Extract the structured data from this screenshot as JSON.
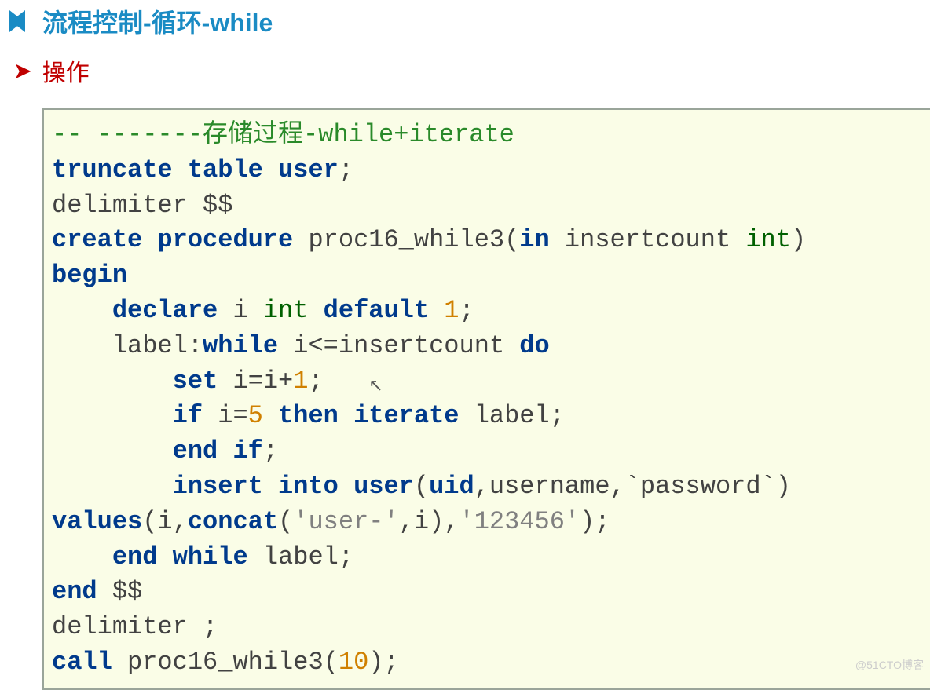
{
  "title": "流程控制-循环-while",
  "subtitle": "操作",
  "watermark": "@51CTO博客",
  "code": {
    "comment": "-- -------存储过程-while+iterate",
    "l1_truncate": "truncate",
    "l1_table": "table",
    "l1_user": "user",
    "l2_delim": "delimiter $$",
    "l3_create": "create",
    "l3_procedure": "procedure",
    "l3_name": " proc16_while3(",
    "l3_in": "in",
    "l3_param": " insertcount ",
    "l3_int": "int",
    "l3_close": ")",
    "l4_begin": "begin",
    "l5_declare": "declare",
    "l5_i": " i ",
    "l5_int": "int",
    "l5_default": "default",
    "l5_one": "1",
    "l6_label": "    label:",
    "l6_while": "while",
    "l6_cond": " i<=insertcount ",
    "l6_do": "do",
    "l7_set": "set",
    "l7_expr1": " i=i",
    "l7_plus": "+",
    "l7_one": "1",
    "l8_if": "if",
    "l8_expr": " i=",
    "l8_five": "5",
    "l8_then": "then",
    "l8_iterate": "iterate",
    "l8_label": " label;",
    "l9_end": "end",
    "l9_if": "if",
    "l10_insert": "insert",
    "l10_into": "into",
    "l10_user": "user",
    "l10_uid": "uid",
    "l10_rest": ",username,`password`)",
    "l11_values": "values",
    "l11_open": "(i,",
    "l11_concat": "concat",
    "l11_str1": "'user-'",
    "l11_mid": ",i),",
    "l11_str2": "'123456'",
    "l11_close": ");",
    "l12_end": "end",
    "l12_while": "while",
    "l12_label": " label;",
    "l13_end": "end",
    "l13_dd": " $$",
    "l14_delim": "delimiter ;",
    "l15_call": "call",
    "l15_name": " proc16_while3(",
    "l15_ten": "10",
    "l15_close": ");"
  }
}
